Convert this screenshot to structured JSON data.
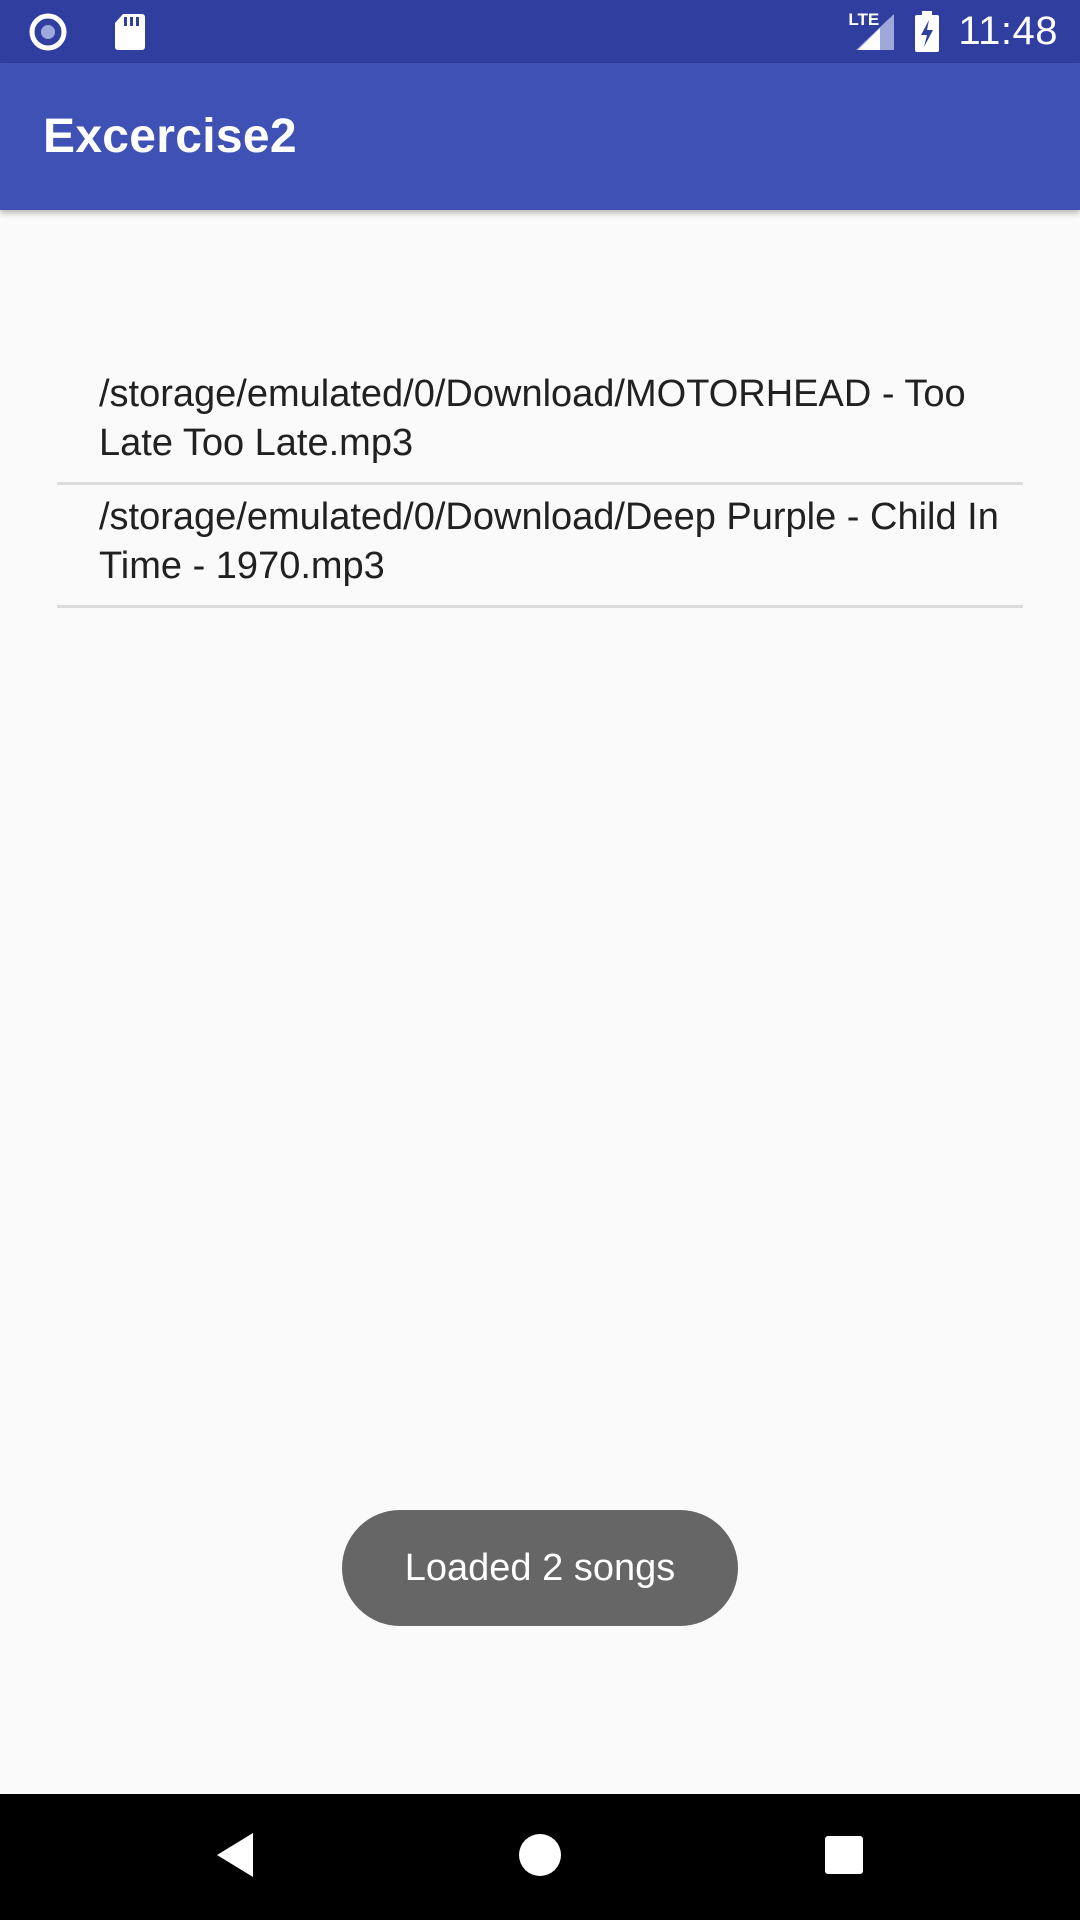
{
  "status_bar": {
    "time": "11:48",
    "network_label": "LTE",
    "icons": [
      "record-icon",
      "sd-card-icon",
      "lte-signal-icon",
      "battery-charging-icon"
    ]
  },
  "app_bar": {
    "title": "Excercise2",
    "color": "#3f51b5"
  },
  "songs": [
    "/storage/emulated/0/Download/MOTORHEAD - Too Late Too Late.mp3",
    "/storage/emulated/0/Download/Deep Purple - Child In Time - 1970.mp3"
  ],
  "toast": {
    "message": "Loaded 2 songs"
  },
  "nav_bar": {
    "icons": [
      "back-icon",
      "home-icon",
      "recents-icon"
    ]
  },
  "colors": {
    "status_bar": "#303f9f",
    "app_bar": "#3f51b5",
    "background": "#fafafa",
    "toast": "#666666"
  }
}
